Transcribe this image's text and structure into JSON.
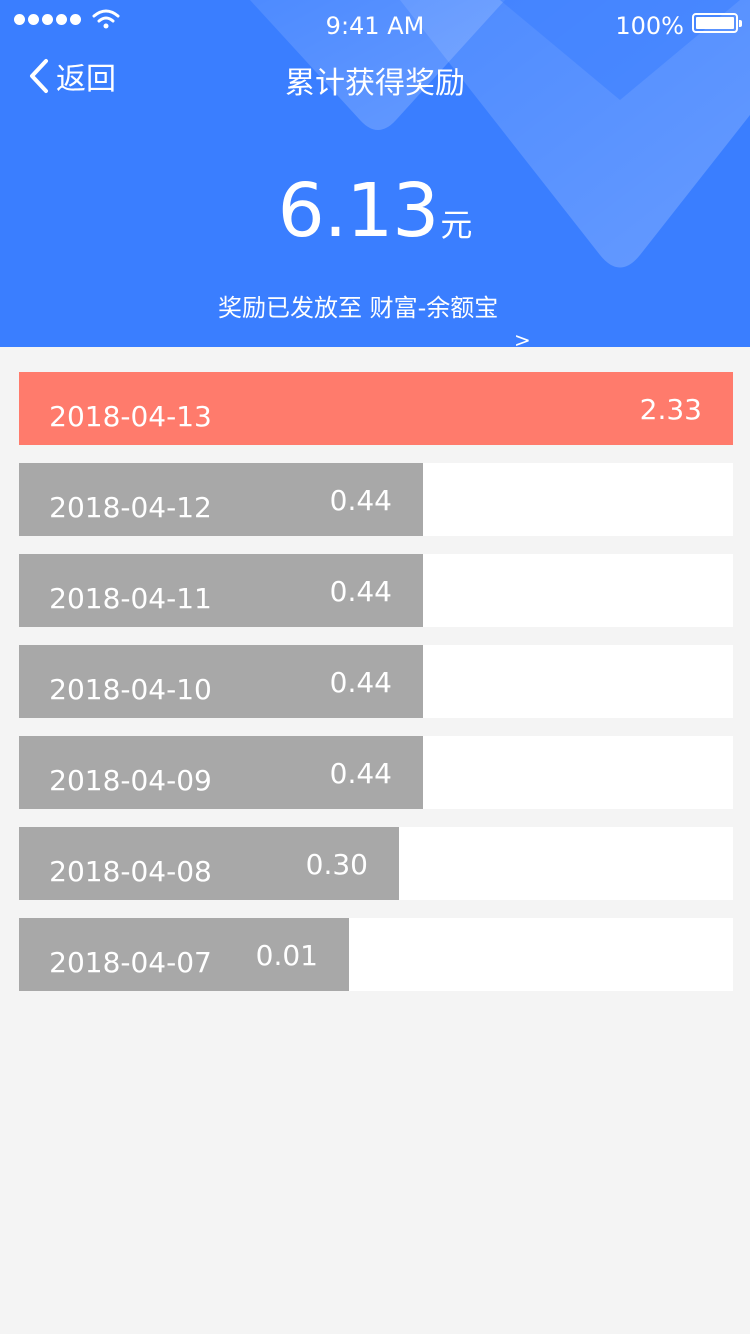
{
  "status_bar": {
    "time": "9:41 AM",
    "battery": "100%"
  },
  "nav": {
    "back_label": "返回",
    "title": "累计获得奖励"
  },
  "summary": {
    "amount": "6.13",
    "unit": "元",
    "destination_text": "奖励已发放至 财富-余额宝",
    "arrow": ">"
  },
  "colors": {
    "header_blue": "#3a7eff",
    "highlight_red": "#ff7b6c",
    "bar_gray": "#a8a8a8",
    "page_bg": "#f4f4f4"
  },
  "rewards": [
    {
      "date": "2018-04-13",
      "amount": "2.33",
      "highlight": true
    },
    {
      "date": "2018-04-12",
      "amount": "0.44",
      "highlight": false
    },
    {
      "date": "2018-04-11",
      "amount": "0.44",
      "highlight": false
    },
    {
      "date": "2018-04-10",
      "amount": "0.44",
      "highlight": false
    },
    {
      "date": "2018-04-09",
      "amount": "0.44",
      "highlight": false
    },
    {
      "date": "2018-04-08",
      "amount": "0.30",
      "highlight": false
    },
    {
      "date": "2018-04-07",
      "amount": "0.01",
      "highlight": false
    }
  ]
}
